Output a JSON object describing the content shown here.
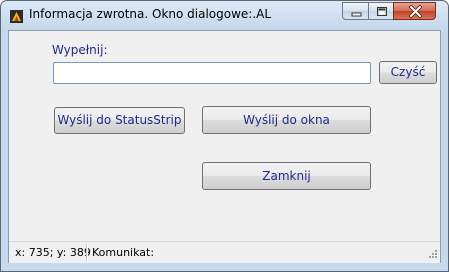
{
  "window": {
    "title": "Informacja zwrotna. Okno dialogowe:.AL",
    "controls": {
      "minimize": "minimize",
      "maximize": "maximize",
      "close": "close"
    }
  },
  "form": {
    "label": "Wypełnij:",
    "input_value": "",
    "clear_button": "Czyść",
    "status_button": "Wyślij do StatusStrip",
    "window_button": "Wyślij do okna",
    "close_button": "Zamknij"
  },
  "statusbar": {
    "coords": "x: 735; y: 389",
    "message": "Komunikat:"
  },
  "icons": {
    "app": "app-icon",
    "minimize": "minimize-icon",
    "maximize": "maximize-icon",
    "close": "close-icon",
    "grip": "resize-grip-icon"
  },
  "colors": {
    "label_text": "#1f2a8a",
    "close_button": "#c1442a",
    "client_bg": "#f0f0f0"
  }
}
